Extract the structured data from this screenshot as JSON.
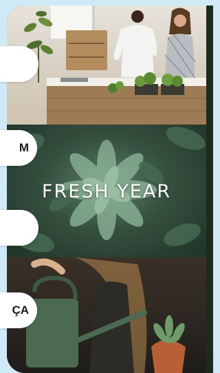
{
  "panels": {
    "top": {
      "alt": "kitchen-people-plants"
    },
    "middle": {
      "title": "FRESH YEAR"
    },
    "bottom": {
      "alt": "watering-can-succulent"
    }
  },
  "buttons": [
    {
      "label": ""
    },
    {
      "label": "M"
    },
    {
      "label": ""
    },
    {
      "label": "ÇA"
    }
  ],
  "colors": {
    "background": "#cfe9f7",
    "button": "#ffffff",
    "title_text": "#ffffff"
  }
}
